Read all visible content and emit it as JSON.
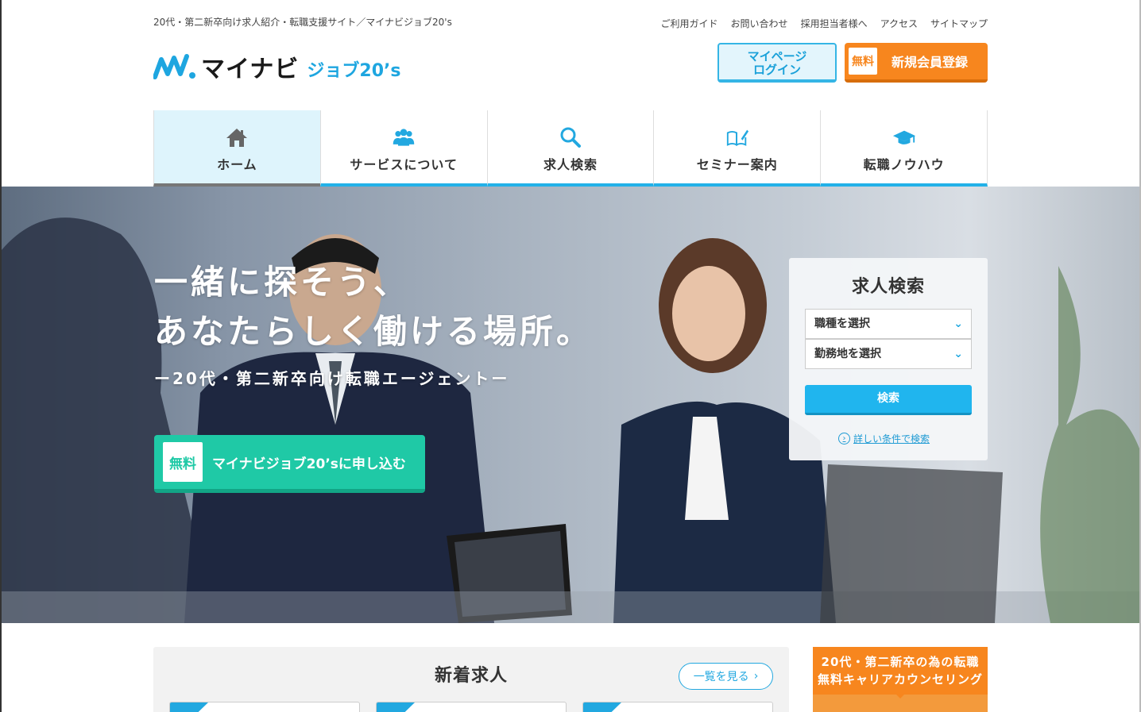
{
  "header": {
    "tagline": "20代・第二新卒向け求人紹介・転職支援サイト／マイナビジョブ20's",
    "util_links": [
      "ご利用ガイド",
      "お問い合わせ",
      "採用担当者様へ",
      "アクセス",
      "サイトマップ"
    ],
    "logo_main": "マイナビ",
    "logo_sub": "ジョブ20’s",
    "mypage_line1": "マイページ",
    "mypage_line2": "ログイン",
    "register_badge": "無料",
    "register_label": "新規会員登録"
  },
  "nav": [
    {
      "label": "ホーム",
      "icon": "home-icon",
      "active": true
    },
    {
      "label": "サービスについて",
      "icon": "users-icon",
      "active": false
    },
    {
      "label": "求人検索",
      "icon": "search-icon",
      "active": false
    },
    {
      "label": "セミナー案内",
      "icon": "book-pen-icon",
      "active": false
    },
    {
      "label": "転職ノウハウ",
      "icon": "graduation-cap-icon",
      "active": false
    }
  ],
  "hero": {
    "line1": "一緒に探そう、",
    "line2": "あなたらしく働ける場所。",
    "sub": "ー20代・第二新卒向け転職エージェントー",
    "apply_badge": "無料",
    "apply_label": "マイナビジョブ20’sに申し込む"
  },
  "search": {
    "title": "求人検索",
    "job_type": "職種を選択",
    "location": "勤務地を選択",
    "button": "検索",
    "detail_link": "詳しい条件で検索"
  },
  "news": {
    "title": "新着求人",
    "see_all": "一覧を見る"
  },
  "counsel": {
    "line1": "20代・第二新卒の為の転職",
    "line2": "無料キャリアカウンセリング"
  },
  "colors": {
    "accent_blue": "#22b1e8",
    "accent_orange": "#f7861e",
    "accent_green": "#1fc9a6"
  }
}
